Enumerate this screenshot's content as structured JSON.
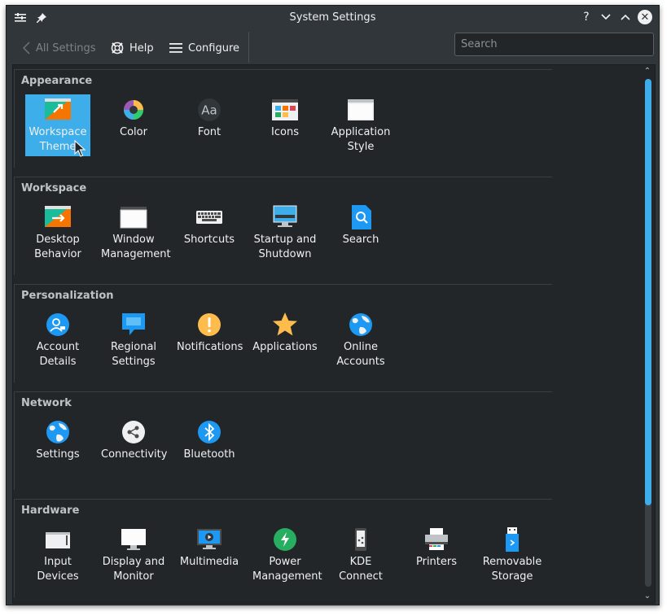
{
  "window": {
    "title": "System Settings"
  },
  "titlebar": {
    "left_icons": [
      "window-menu-icon",
      "pin-icon"
    ],
    "buttons": {
      "help": "?",
      "minimize": "⌄",
      "maximize": "⌃",
      "close": "✕"
    }
  },
  "toolbar": {
    "back_label": "All Settings",
    "help_label": "Help",
    "configure_label": "Configure",
    "search_placeholder": "Search"
  },
  "sections": [
    {
      "title": "Appearance",
      "items": [
        {
          "label_lines": [
            "Workspace",
            "Theme"
          ],
          "icon": "workspace-theme-icon",
          "selected": true
        },
        {
          "label_lines": [
            "Color"
          ],
          "icon": "color-icon"
        },
        {
          "label_lines": [
            "Font"
          ],
          "icon": "font-icon",
          "glyph": "Aa"
        },
        {
          "label_lines": [
            "Icons"
          ],
          "icon": "icons-icon"
        },
        {
          "label_lines": [
            "Application",
            "Style"
          ],
          "icon": "application-style-icon"
        }
      ]
    },
    {
      "title": "Workspace",
      "items": [
        {
          "label_lines": [
            "Desktop",
            "Behavior"
          ],
          "icon": "desktop-behavior-icon"
        },
        {
          "label_lines": [
            "Window",
            "Management"
          ],
          "icon": "window-management-icon"
        },
        {
          "label_lines": [
            "Shortcuts"
          ],
          "icon": "shortcuts-icon"
        },
        {
          "label_lines": [
            "Startup and",
            "Shutdown"
          ],
          "icon": "startup-shutdown-icon"
        },
        {
          "label_lines": [
            "Search"
          ],
          "icon": "search-icon"
        }
      ]
    },
    {
      "title": "Personalization",
      "items": [
        {
          "label_lines": [
            "Account",
            "Details"
          ],
          "icon": "account-details-icon"
        },
        {
          "label_lines": [
            "Regional",
            "Settings"
          ],
          "icon": "regional-settings-icon"
        },
        {
          "label_lines": [
            "Notifications"
          ],
          "icon": "notifications-icon",
          "glyph": "!"
        },
        {
          "label_lines": [
            "Applications"
          ],
          "icon": "applications-icon"
        },
        {
          "label_lines": [
            "Online",
            "Accounts"
          ],
          "icon": "online-accounts-icon"
        }
      ]
    },
    {
      "title": "Network",
      "items": [
        {
          "label_lines": [
            "Settings"
          ],
          "icon": "network-settings-icon"
        },
        {
          "label_lines": [
            "Connectivity"
          ],
          "icon": "connectivity-icon"
        },
        {
          "label_lines": [
            "Bluetooth"
          ],
          "icon": "bluetooth-icon",
          "glyph": "ᛒ"
        }
      ]
    },
    {
      "title": "Hardware",
      "items": [
        {
          "label_lines": [
            "Input",
            "Devices"
          ],
          "icon": "input-devices-icon"
        },
        {
          "label_lines": [
            "Display and",
            "Monitor"
          ],
          "icon": "display-monitor-icon"
        },
        {
          "label_lines": [
            "Multimedia"
          ],
          "icon": "multimedia-icon"
        },
        {
          "label_lines": [
            "Power",
            "Management"
          ],
          "icon": "power-management-icon"
        },
        {
          "label_lines": [
            "KDE Connect"
          ],
          "icon": "kde-connect-icon"
        },
        {
          "label_lines": [
            "Printers"
          ],
          "icon": "printers-icon"
        },
        {
          "label_lines": [
            "Removable",
            "Storage"
          ],
          "icon": "removable-storage-icon"
        }
      ]
    }
  ],
  "colors": {
    "accent": "#3daee9",
    "window_bg": "#31363b",
    "view_bg": "#232629",
    "text": "#eff0f1"
  }
}
